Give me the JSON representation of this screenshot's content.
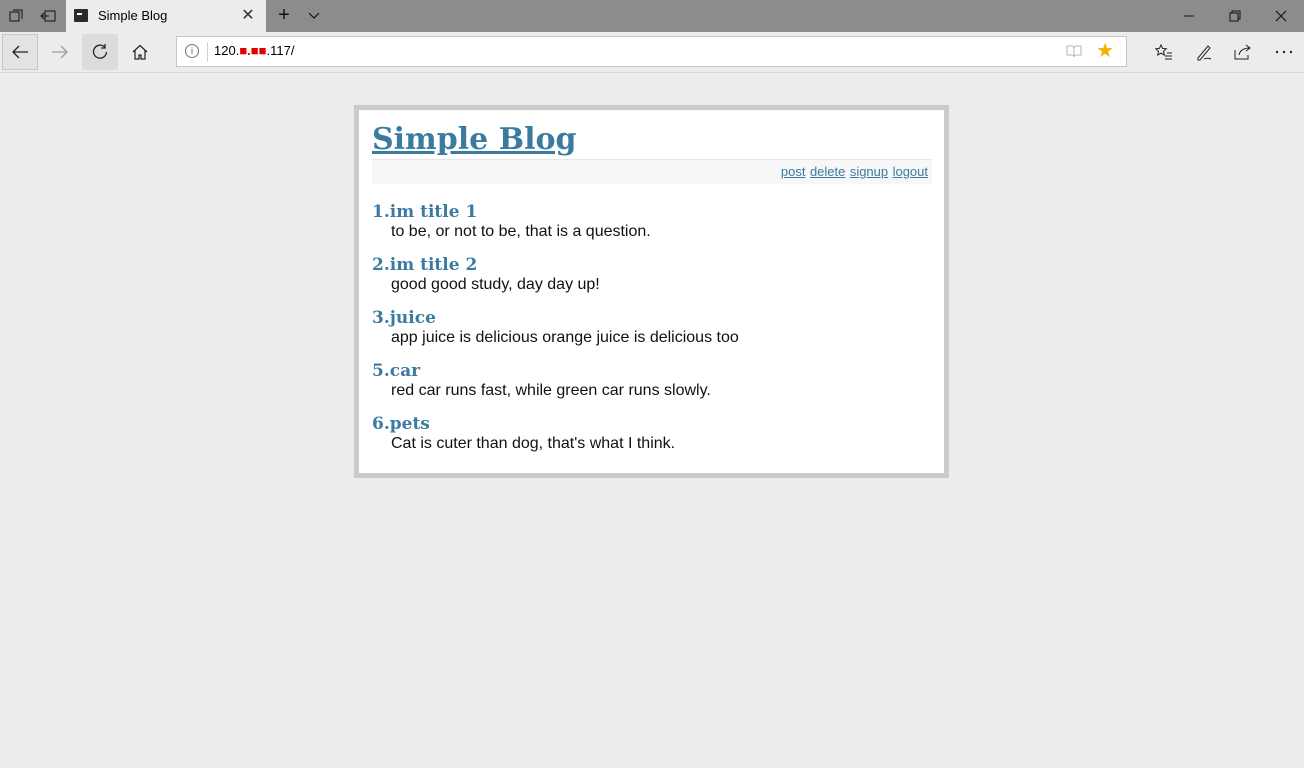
{
  "browser": {
    "tab_title": "Simple Blog",
    "address": {
      "prefix": "120.",
      "redacted": "■.■■",
      "suffix": ".117/"
    }
  },
  "blog": {
    "title": "Simple Blog",
    "menu": {
      "post": "post",
      "delete": "delete",
      "signup": "signup",
      "logout": "logout"
    },
    "posts": [
      {
        "title": "1.im title 1",
        "body": "to be, or not to be, that is a question."
      },
      {
        "title": "2.im title 2",
        "body": "good good study, day day up!"
      },
      {
        "title": "3.juice",
        "body": "app juice is delicious orange juice is delicious too"
      },
      {
        "title": "5.car",
        "body": "red car runs fast, while green car runs slowly."
      },
      {
        "title": "6.pets",
        "body": "Cat is cuter than dog, that's what I think."
      }
    ]
  },
  "colors": {
    "link": "#3b7ba0",
    "star": "#f2b200",
    "redaction": "#e00000"
  }
}
